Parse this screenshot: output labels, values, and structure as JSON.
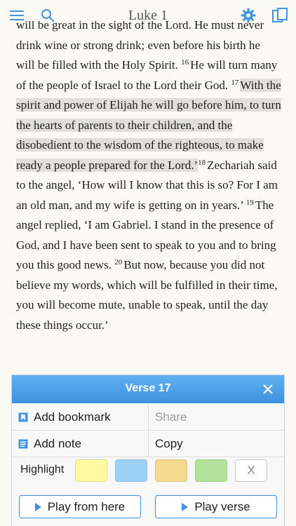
{
  "header": {
    "title": "Luke 1"
  },
  "reading": {
    "line1": "will be great in the sight of the Lord. He must never",
    "line2": "drink wine or strong drink; even before his birth he",
    "line3": "will be filled with the Holy Spirit. ",
    "v16": "16",
    "v16_text": "He will turn many of the people of Israel to the Lord their God. ",
    "v17": "17",
    "v17_text": "With the spirit and power of Elijah he will go before him, to turn the hearts of parents to their children, and the disobedient to the wisdom of the righteous, to make ready a people prepared for the Lord.’",
    "v18": "18",
    "v18_text": "Zechariah said to the angel, ‘How will I know that this is so? For I am an old man, and my wife is getting on in years.’ ",
    "v19": "19",
    "v19_text": "The angel replied, ‘I am Gabriel. I stand in the presence of God, and I have been sent to speak to you and to bring you this good news. ",
    "v20": "20",
    "v20_text": "But now, because you did not believe my words, which will be fulfilled in their time, you will become mute, unable to speak, until the day these things occur.’"
  },
  "popup": {
    "title": "Verse 17",
    "add_bookmark": "Add bookmark",
    "share": "Share",
    "add_note": "Add note",
    "copy": "Copy",
    "highlight": "Highlight",
    "clear_label": "X",
    "play_from_here": "Play from here",
    "play_verse": "Play verse"
  },
  "colors": {
    "accent": "#3f93df",
    "highlight_yellow": "#fffaa0",
    "highlight_blue": "#9dd0f5",
    "highlight_orange": "#f5d98f",
    "highlight_green": "#b3e39a"
  }
}
